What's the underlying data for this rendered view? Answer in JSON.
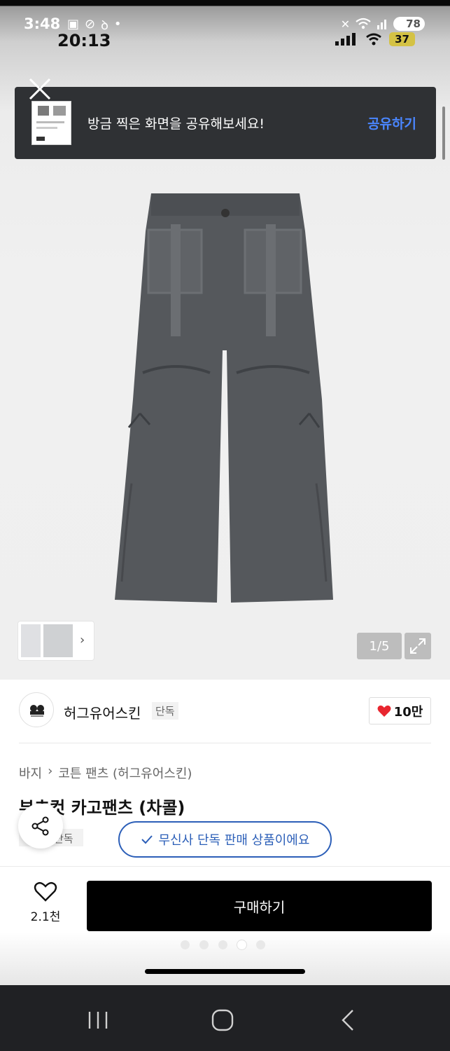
{
  "status_bar_outer": {
    "time": "3:48",
    "battery": "78"
  },
  "status_bar_inner": {
    "time": "20:13",
    "battery": "37"
  },
  "toast": {
    "message": "방금 찍은 화면을 공유해보세요!",
    "action_label": "공유하기"
  },
  "gallery": {
    "counter": "1/5"
  },
  "brand": {
    "name": "허그유어스킨",
    "badge": "단독",
    "like_count": "10만"
  },
  "breadcrumb": {
    "items": [
      "바지",
      "코튼 팬츠 (허그유어스킨)"
    ]
  },
  "product": {
    "title": "부츠컷 카고팬츠 (차콜)",
    "tag": "단독",
    "exclusive_notice": "무신사 단독 판매 상품이에요"
  },
  "bottom_bar": {
    "wish_count": "2.1천",
    "buy_label": "구매하기"
  },
  "pager": {
    "count": 5,
    "active_index": 3
  },
  "colors": {
    "accent_blue": "#2c5fb8",
    "toast_action": "#4a86ff",
    "heart_red": "#e8262f",
    "buy_button": "#000000"
  }
}
